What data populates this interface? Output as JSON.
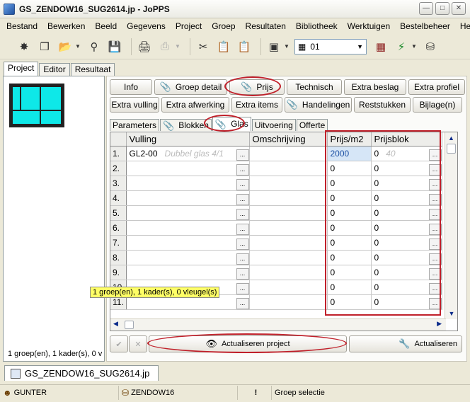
{
  "window": {
    "title": "GS_ZENDOW16_SUG2614.jp - JoPPS"
  },
  "menu": [
    "Bestand",
    "Bewerken",
    "Beeld",
    "Gegevens",
    "Project",
    "Groep",
    "Resultaten",
    "Bibliotheek",
    "Werktuigen",
    "Bestelbeheer",
    "Help"
  ],
  "toolbar": {
    "select_value": "01"
  },
  "panel_tabs": [
    "Project",
    "Editor",
    "Resultaat"
  ],
  "left_status": "1 groep(en), 1 kader(s), 0 v",
  "buttons_row1": [
    "Info",
    "Groep detail",
    "Prijs",
    "Technisch",
    "Extra beslag",
    "Extra profiel"
  ],
  "buttons_row2": [
    "Extra vulling",
    "Extra afwerking",
    "Extra items",
    "Handelingen",
    "Reststukken",
    "Bijlage(n)"
  ],
  "sub_tabs": [
    "Parameters",
    "Blokken",
    "Glas",
    "Uitvoering",
    "Offerte"
  ],
  "grid": {
    "columns": [
      "Vulling",
      "Omschrijving",
      "Prijs/m2",
      "Prijsblok"
    ],
    "rows": [
      {
        "num": "1.",
        "vulling": "GL2-00",
        "vulling_hint": "Dubbel glas 4/1",
        "prijs_m2": "2000",
        "prijsblok": "0",
        "prijsblok_hint": "40"
      },
      {
        "num": "2.",
        "vulling": "",
        "vulling_hint": "",
        "prijs_m2": "0",
        "prijsblok": "0",
        "prijsblok_hint": ""
      },
      {
        "num": "3.",
        "vulling": "",
        "vulling_hint": "",
        "prijs_m2": "0",
        "prijsblok": "0",
        "prijsblok_hint": ""
      },
      {
        "num": "4.",
        "vulling": "",
        "vulling_hint": "",
        "prijs_m2": "0",
        "prijsblok": "0",
        "prijsblok_hint": ""
      },
      {
        "num": "5.",
        "vulling": "",
        "vulling_hint": "",
        "prijs_m2": "0",
        "prijsblok": "0",
        "prijsblok_hint": ""
      },
      {
        "num": "6.",
        "vulling": "",
        "vulling_hint": "",
        "prijs_m2": "0",
        "prijsblok": "0",
        "prijsblok_hint": ""
      },
      {
        "num": "7.",
        "vulling": "",
        "vulling_hint": "",
        "prijs_m2": "0",
        "prijsblok": "0",
        "prijsblok_hint": ""
      },
      {
        "num": "8.",
        "vulling": "",
        "vulling_hint": "",
        "prijs_m2": "0",
        "prijsblok": "0",
        "prijsblok_hint": ""
      },
      {
        "num": "9.",
        "vulling": "",
        "vulling_hint": "",
        "prijs_m2": "0",
        "prijsblok": "0",
        "prijsblok_hint": ""
      },
      {
        "num": "10.",
        "vulling": "",
        "vulling_hint": "",
        "prijs_m2": "0",
        "prijsblok": "0",
        "prijsblok_hint": ""
      },
      {
        "num": "11.",
        "vulling": "",
        "vulling_hint": "",
        "prijs_m2": "0",
        "prijsblok": "0",
        "prijsblok_hint": ""
      }
    ]
  },
  "tooltip": "1 groep(en), 1 kader(s), 0 vleugel(s)",
  "actions": {
    "refresh_project": "Actualiseren project",
    "refresh": "Actualiseren"
  },
  "doc_tab": "GS_ZENDOW16_SUG2614.jp",
  "status": {
    "user": "GUNTER",
    "file": "ZENDOW16",
    "mode": "Groep selectie"
  },
  "colors": {
    "highlight_oval": "#c0202a",
    "thumbnail_glass": "#0ee8e8",
    "tooltip_bg": "#ffff66"
  }
}
